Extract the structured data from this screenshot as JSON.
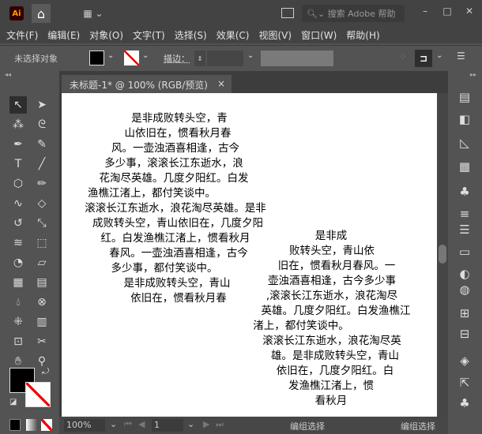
{
  "app": {
    "logo": "Ai",
    "search_placeholder": "搜索 Adobe 帮助"
  },
  "menu": [
    "文件(F)",
    "编辑(E)",
    "对象(O)",
    "文字(T)",
    "选择(S)",
    "效果(C)",
    "视图(V)",
    "窗口(W)",
    "帮助(H)"
  ],
  "control": {
    "selection_label": "未选择对象",
    "stroke_label": "描边："
  },
  "document": {
    "tab_title": "未标题-1* @ 100% (RGB/预览)",
    "close": "×"
  },
  "text_left": [
    "是非成败转头空，青",
    "山依旧在，惯看秋月春",
    "风。一壶浊酒喜相逢，古今",
    "多少事，滚滚长江东逝水，浪",
    "花淘尽英雄。几度夕阳红。白发",
    "渔樵江渚上，都付笑谈中。",
    "滚滚长江东逝水，浪花淘尽英雄。是非",
    "成败转头空，青山依旧在，几度夕阳",
    "红。白发渔樵江渚上，惯看秋月",
    "春风。一壶浊酒喜相逢，古今",
    "多少事，都付笑谈中。",
    "是非成败转头空，青山",
    "依旧在，惯看秋月春"
  ],
  "text_right": [
    "是非成",
    "败转头空，青山依",
    "旧在，惯看秋月春风。一",
    "壶浊酒喜相逢，古今多少事",
    ",滚滚长江东逝水，浪花淘尽",
    "英雄。几度夕阳红。白发渔樵江",
    "渚上，都付笑谈中。",
    "滚滚长江东逝水，浪花淘尽英",
    "雄。是非成败转头空，青山",
    "依旧在，几度夕阳红。白",
    "发渔樵江渚上，惯",
    "看秋月"
  ],
  "status": {
    "zoom": "100%",
    "page": "1",
    "mode_left": "编组选择",
    "mode_right": "编组选择"
  },
  "colors": {
    "fill": "#000000",
    "stroke": "none",
    "logo_bg": "#330000",
    "logo_fg": "#ff9a00"
  }
}
